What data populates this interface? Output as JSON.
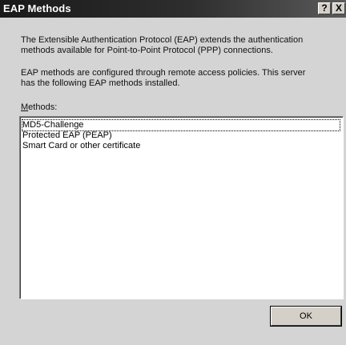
{
  "window": {
    "title": "EAP Methods",
    "help_label": "?",
    "close_label": "X"
  },
  "description": {
    "para1_line1": "The Extensible Authentication Protocol (EAP) extends the authentication",
    "para1_line2": "methods available for Point-to-Point Protocol (PPP) connections.",
    "para2_line1": "EAP methods are configured through remote access policies. This server",
    "para2_line2": "has the following EAP methods installed."
  },
  "methods": {
    "label_mnemonic": "M",
    "label_rest": "ethods:",
    "items": [
      "MD5-Challenge",
      "Protected EAP (PEAP)",
      "Smart Card or other certificate"
    ]
  },
  "buttons": {
    "ok_label": "OK"
  },
  "colors": {
    "dialog_bg": "#d4d4d4",
    "titlebar_start": "#1a1a1a",
    "titlebar_end": "#5a5a5a",
    "list_bg": "#ffffff"
  }
}
